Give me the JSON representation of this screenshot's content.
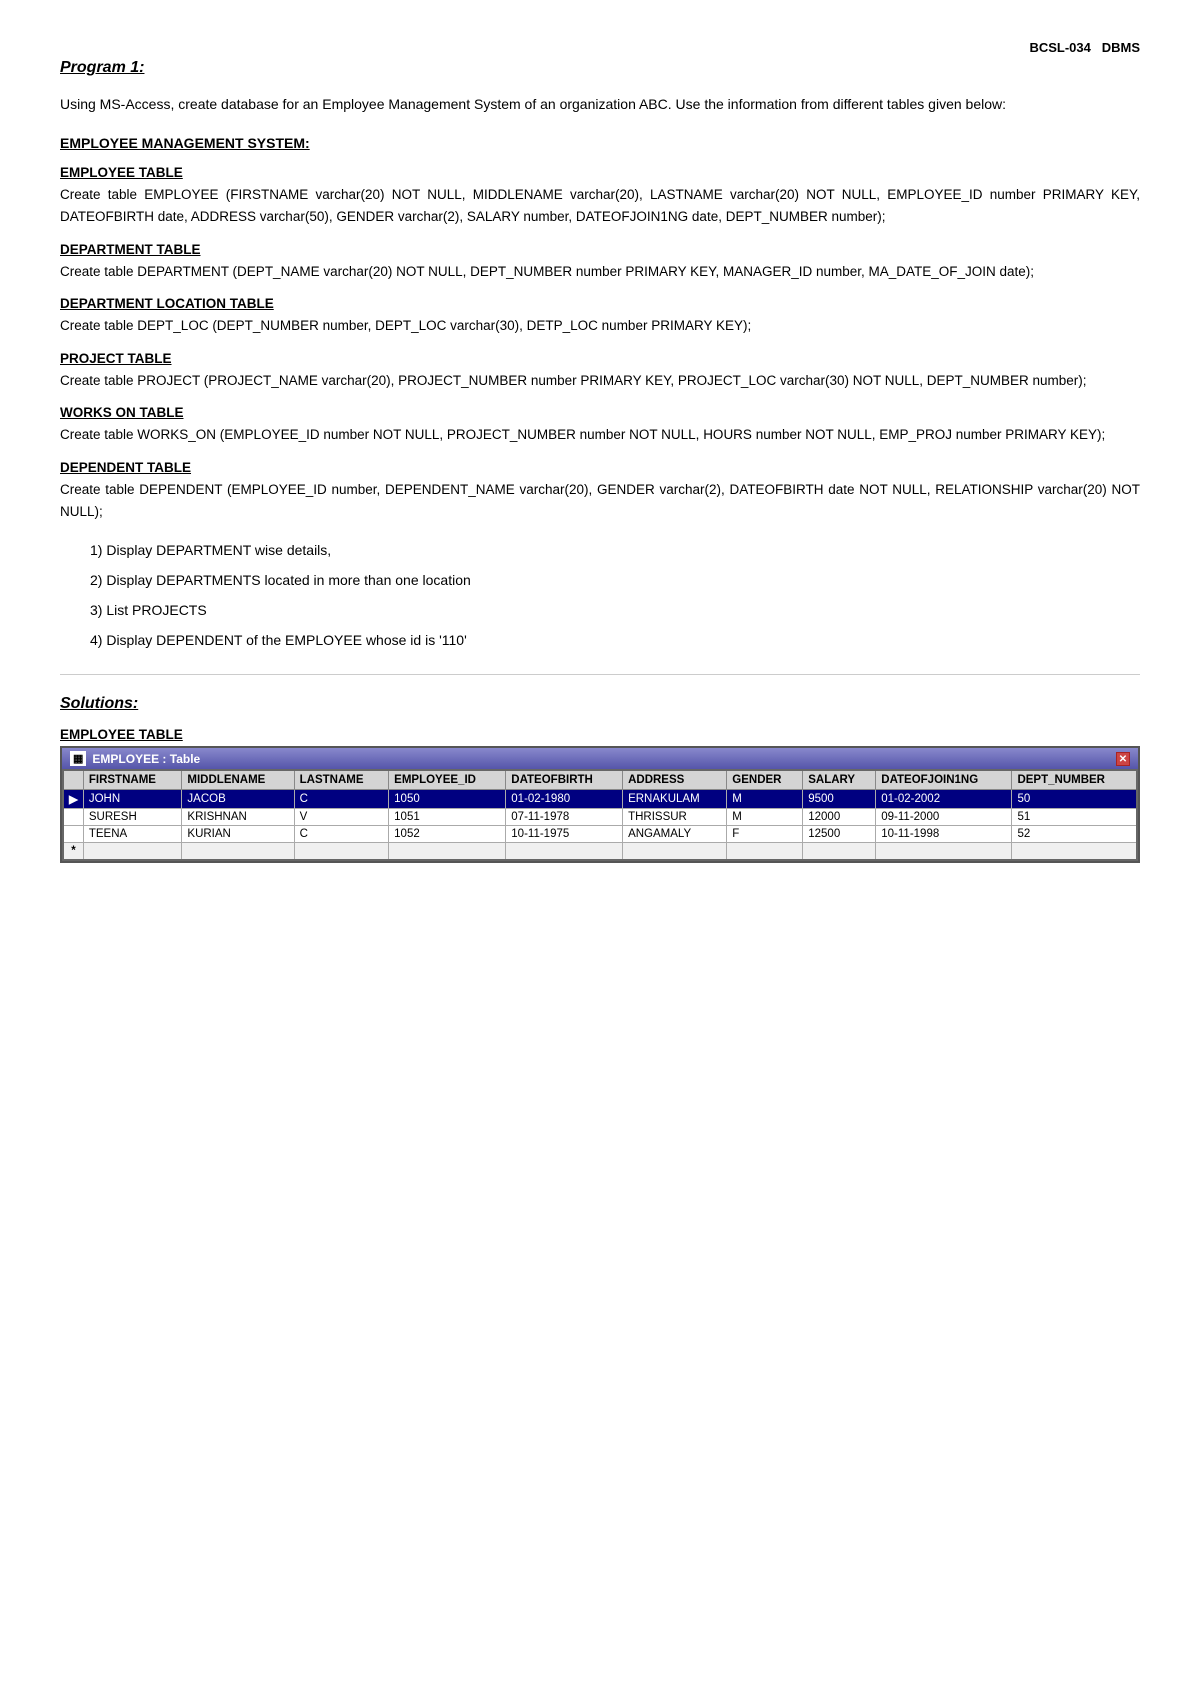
{
  "header": {
    "code": "BCSL-034",
    "subject": "DBMS"
  },
  "program": {
    "title": "Program 1:",
    "intro": "Using MS-Access, create database for an Employee Management System of an organization ABC. Use the information from different tables given below:"
  },
  "ems_heading": "EMPLOYEE MANAGEMENT SYSTEM:",
  "tables": [
    {
      "heading": "EMPLOYEE TABLE",
      "desc": "Create table EMPLOYEE (FIRSTNAME varchar(20) NOT NULL, MIDDLENAME varchar(20), LASTNAME varchar(20) NOT NULL, EMPLOYEE_ID number PRIMARY KEY, DATEOFBIRTH date, ADDRESS varchar(50), GENDER varchar(2), SALARY number, DATEOFJOIN1NG date, DEPT_NUMBER number);"
    },
    {
      "heading": "DEPARTMENT TABLE",
      "desc": "Create table DEPARTMENT (DEPT_NAME varchar(20) NOT NULL, DEPT_NUMBER number PRIMARY KEY, MANAGER_ID number, MA_DATE_OF_JOIN date);"
    },
    {
      "heading": "DEPARTMENT LOCATION TABLE",
      "desc": "Create table DEPT_LOC (DEPT_NUMBER number, DEPT_LOC varchar(30), DETP_LOC number PRIMARY KEY);"
    },
    {
      "heading": "PROJECT TABLE",
      "desc": "Create table PROJECT (PROJECT_NAME varchar(20), PROJECT_NUMBER number PRIMARY KEY, PROJECT_LOC varchar(30) NOT NULL, DEPT_NUMBER number);"
    },
    {
      "heading": "WORKS ON TABLE",
      "desc": "Create table WORKS_ON (EMPLOYEE_ID number NOT NULL, PROJECT_NUMBER number NOT NULL, HOURS number NOT NULL, EMP_PROJ number PRIMARY KEY);"
    },
    {
      "heading": "DEPENDENT TABLE",
      "desc": "Create table DEPENDENT (EMPLOYEE_ID number, DEPENDENT_NAME varchar(20), GENDER varchar(2), DATEOFBIRTH date NOT NULL, RELATIONSHIP varchar(20) NOT NULL);"
    }
  ],
  "questions": {
    "label": "",
    "items": [
      "1)  Display DEPARTMENT wise details,",
      "2)  Display DEPARTMENTS located in more than one location",
      "3)  List PROJECTS",
      "4)  Display DEPENDENT of the EMPLOYEE whose id is '110'"
    ]
  },
  "solutions": {
    "heading": "Solutions:"
  },
  "employee_table": {
    "label": "EMPLOYEE TABLE",
    "title": "EMPLOYEE : Table",
    "columns": [
      "FIRSTNAME",
      "MIDDLENAME",
      "LASTNAME",
      "EMPLOYEE_ID",
      "DATEOFBIRTH",
      "ADDRESS",
      "GENDER",
      "SALARY",
      "DATEOFJOIN1NG",
      "DEPT_NUMBER"
    ],
    "rows": [
      {
        "indicator": "▶",
        "selected": true,
        "data": [
          "JOHN",
          "JACOB",
          "C",
          "1050",
          "01-02-1980",
          "ERNAKULAM",
          "M",
          "",
          "9500",
          "01-02-2002",
          "50"
        ]
      },
      {
        "indicator": "",
        "selected": false,
        "data": [
          "SURESH",
          "KRISHNAN",
          "V",
          "1051",
          "07-11-1978",
          "THRISSUR",
          "M",
          "",
          "12000",
          "09-11-2000",
          "51"
        ]
      },
      {
        "indicator": "",
        "selected": false,
        "data": [
          "TEENA",
          "KURIAN",
          "C",
          "1052",
          "10-11-1975",
          "ANGAMALY",
          "F",
          "",
          "12500",
          "10-11-1998",
          "52"
        ]
      },
      {
        "indicator": "*",
        "new": true,
        "data": [
          "",
          "",
          "",
          "",
          "",
          "",
          "",
          "",
          "",
          "",
          ""
        ]
      }
    ]
  }
}
